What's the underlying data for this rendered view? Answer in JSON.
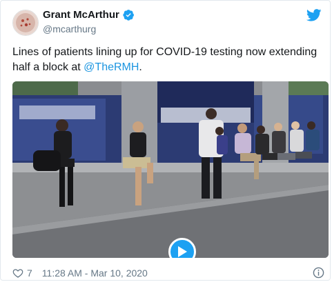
{
  "tweet": {
    "author_name": "Grant McArthur",
    "author_handle": "@mcarthurg",
    "text_before": "Lines of patients lining up for COVID-19 testing now extending half a block at ",
    "mention": "@TheRMH",
    "text_after": ".",
    "like_count": "7",
    "timestamp": "11:28 AM - Mar 10, 2020"
  },
  "icons": {
    "verified": "verified-badge-icon",
    "logo": "twitter-bird-icon",
    "play": "play-icon",
    "like": "heart-icon",
    "info": "info-icon"
  },
  "colors": {
    "brand": "#1da1f2",
    "link": "#1b95e0",
    "secondary_text": "#657786",
    "border": "#e1e8ed"
  }
}
